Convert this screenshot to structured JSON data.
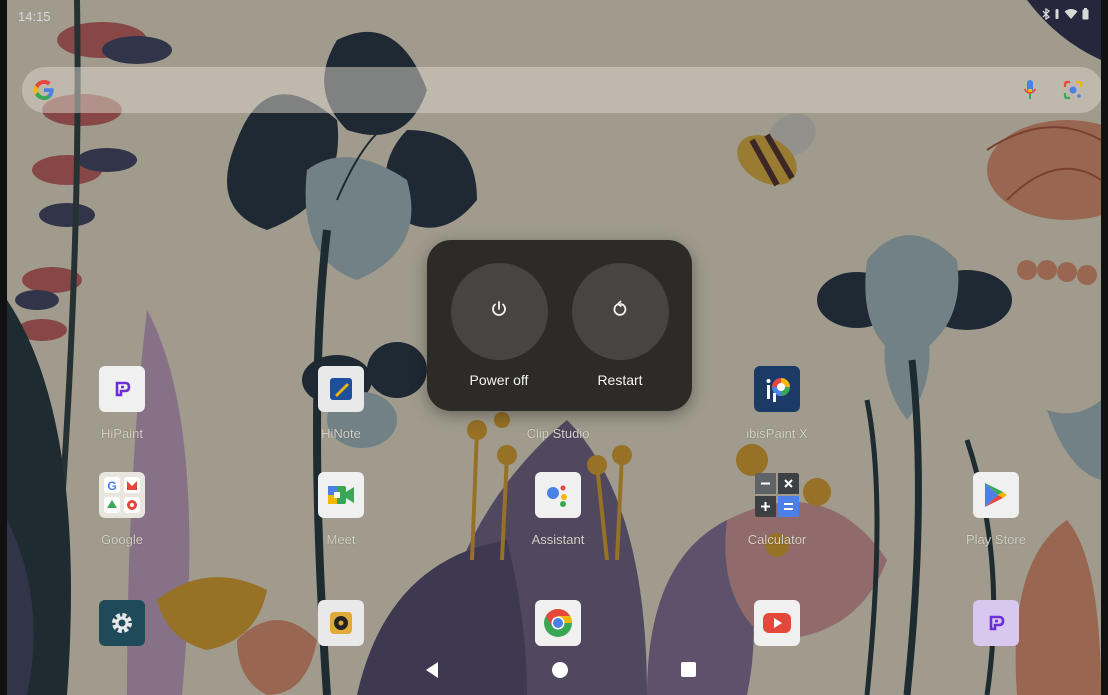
{
  "status_bar": {
    "time": "14:15",
    "icons": [
      "bluetooth-icon",
      "vibrate-icon",
      "wifi-icon",
      "battery-icon"
    ]
  },
  "search_bar": {
    "logo": "google-g-logo",
    "icons": [
      "microphone-icon",
      "google-lens-icon"
    ]
  },
  "power_menu": {
    "actions": [
      {
        "label": "Power off",
        "icon": "power-icon"
      },
      {
        "label": "Restart",
        "icon": "restart-icon"
      }
    ]
  },
  "apps": {
    "row1": [
      {
        "label": "HiPaint",
        "icon": "hipaint-icon"
      },
      {
        "label": "HiNote",
        "icon": "hinote-icon"
      },
      {
        "label": "Clip Studio",
        "icon": "clip-studio-icon"
      },
      {
        "label": "ibisPaint X",
        "icon": "ibispaint-icon"
      }
    ],
    "row2": [
      {
        "label": "Google",
        "icon": "google-folder-icon"
      },
      {
        "label": "Meet",
        "icon": "meet-icon"
      },
      {
        "label": "Assistant",
        "icon": "assistant-icon"
      },
      {
        "label": "Calculator",
        "icon": "calculator-icon"
      },
      {
        "label": "Play Store",
        "icon": "play-store-icon"
      }
    ],
    "dock": [
      {
        "icon": "settings-icon"
      },
      {
        "icon": "music-player-icon"
      },
      {
        "icon": "chrome-icon"
      },
      {
        "icon": "youtube-icon"
      },
      {
        "icon": "hipaint-icon"
      }
    ]
  },
  "nav_bar": {
    "buttons": [
      "back-icon",
      "home-icon",
      "recents-icon"
    ]
  },
  "colors": {
    "dialog_bg": "#2c2b28",
    "action_circle": "#464541",
    "label_text": "#f3f3f3"
  }
}
